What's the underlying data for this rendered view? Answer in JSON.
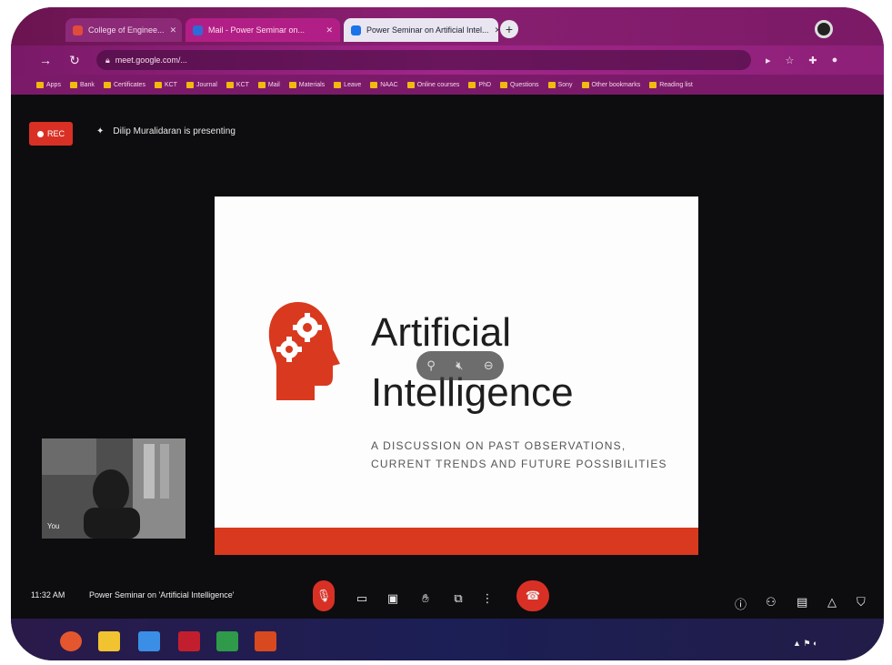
{
  "tabs": [
    {
      "title": "College of Enginee...",
      "fav_color": "#e14b3a"
    },
    {
      "title": "Mail - Power Seminar on...",
      "fav_color": "#2f6ad9"
    },
    {
      "title": "Power Seminar on Artificial Intel...",
      "fav_color": "#1a73e8"
    }
  ],
  "address": {
    "url": "meet.google.com/..."
  },
  "bookmarks": [
    "Apps",
    "Bank",
    "Certificates",
    "KCT",
    "Journal",
    "KCT",
    "Mail",
    "Materials",
    "Leave",
    "NAAC",
    "Online courses",
    "PhD",
    "Questions",
    "Sony",
    "Other bookmarks",
    "Reading list"
  ],
  "meet": {
    "rec_label": "REC",
    "presenter_text": "Dilip Muralidaran is presenting",
    "self_label": "You",
    "time": "11:32 AM",
    "meeting_title": "Power Seminar on 'Artificial Intelligence'"
  },
  "slide": {
    "title_line1": "Artificial",
    "title_line2": "Intelligence",
    "subtitle_line1": "A DISCUSSION ON PAST OBSERVATIONS,",
    "subtitle_line2": "CURRENT TRENDS AND FUTURE POSSIBILITIES",
    "accent": "#d9391f"
  },
  "icons": {
    "mic": "microphone-icon",
    "hangup": "hangup-icon"
  }
}
